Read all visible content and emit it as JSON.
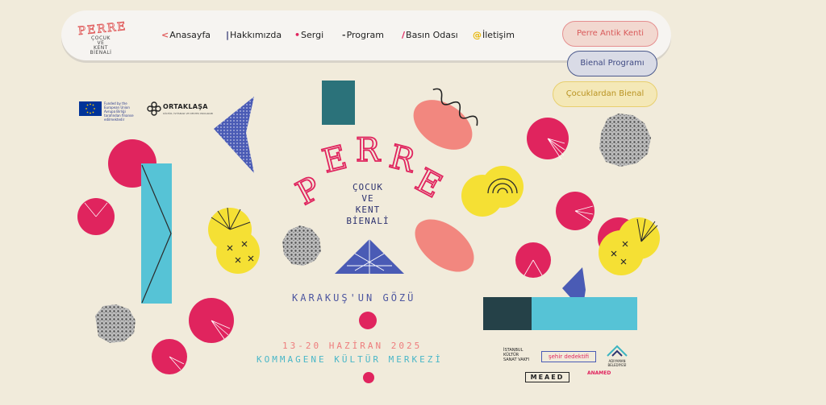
{
  "brand": {
    "logo_word": "PERRE",
    "logo_sub": [
      "ÇOCUK",
      "VE",
      "KENT",
      "BİENALİ"
    ]
  },
  "nav": {
    "items": [
      {
        "mark": "<",
        "mark_color": "#e05b5b",
        "label": "Anasayfa"
      },
      {
        "mark": "|",
        "mark_color": "#2f3470",
        "label": "Hakkımızda"
      },
      {
        "mark": "•",
        "mark_color": "#e0245e",
        "label": "Sergi"
      },
      {
        "mark": "-",
        "mark_color": "#444444",
        "label": "Program"
      },
      {
        "mark": "/",
        "mark_color": "#e0245e",
        "label": "Basın Odası"
      },
      {
        "mark": "@",
        "mark_color": "#e6b400",
        "label": "İletişim"
      }
    ]
  },
  "buttons": {
    "antik_kent": "Perre Antik Kenti",
    "bienal_programi": "Bienal Programı",
    "cocuklardan": "Çocuklardan Bienal"
  },
  "sponsors": {
    "eu_text": "Funded by the European Union Avrupa Birliği tarafından finanse edilmektedir",
    "ortaklasa": "ORTAKLAŞA",
    "ortaklasa_sub": "KÜLTÜR, İSTİSMAR VE DESTEK PROGRAMI",
    "istanbul": "İSTANBUL KÜLTÜR SANAT VAKFI",
    "sehir": "şehir dedektifi",
    "adiyaman": "ADIYAMAN BELEDİYESİ",
    "mead": "MEAED",
    "anamed": "ANAMED"
  },
  "hero": {
    "title_letters": "PERRE",
    "title_sub": [
      "ÇOCUK",
      "VE",
      "KENT",
      "BİENALİ"
    ],
    "theme": "KARAKUŞ'UN GÖZÜ",
    "dates": "13-20 HAZİRAN 2025",
    "venue": "KOMMAGENE KÜLTÜR MERKEZİ"
  },
  "colors": {
    "background": "#f1ebdb",
    "magenta": "#e0245e",
    "blue": "#4a5bb5",
    "cyan": "#56c3d6",
    "yellow": "#f5e034",
    "salmon": "#f2877f"
  }
}
